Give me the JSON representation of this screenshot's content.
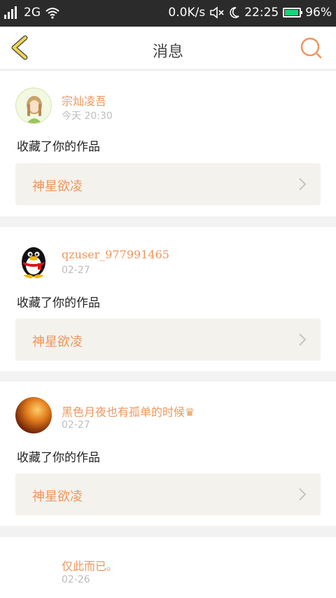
{
  "statusbar": {
    "network": "2G",
    "speed": "0.0K/s",
    "time": "22:25",
    "battery": "96%",
    "battery_level": 0.96
  },
  "header": {
    "title": "消息"
  },
  "colors": {
    "accent": "#f0955c",
    "back": "#f0d64c",
    "battery": "#1fd27a"
  },
  "messages": [
    {
      "user": "宗灿凌吾",
      "time": "今天 20:30",
      "action": "收藏了你的作品",
      "work": "神星欲凌",
      "avatar": "girl-avatar"
    },
    {
      "user": "qzuser_977991465",
      "time": "02-27",
      "action": "收藏了你的作品",
      "work": "神星欲凌",
      "avatar": "qq-penguin-avatar"
    },
    {
      "user": "黑色月夜也有孤单的时候♛",
      "time": "02-27",
      "action": "收藏了你的作品",
      "work": "神星欲凌",
      "avatar": "sunset-avatar"
    },
    {
      "user": "仅此而已。",
      "time": "02-26",
      "avatar": "blank-avatar"
    }
  ]
}
